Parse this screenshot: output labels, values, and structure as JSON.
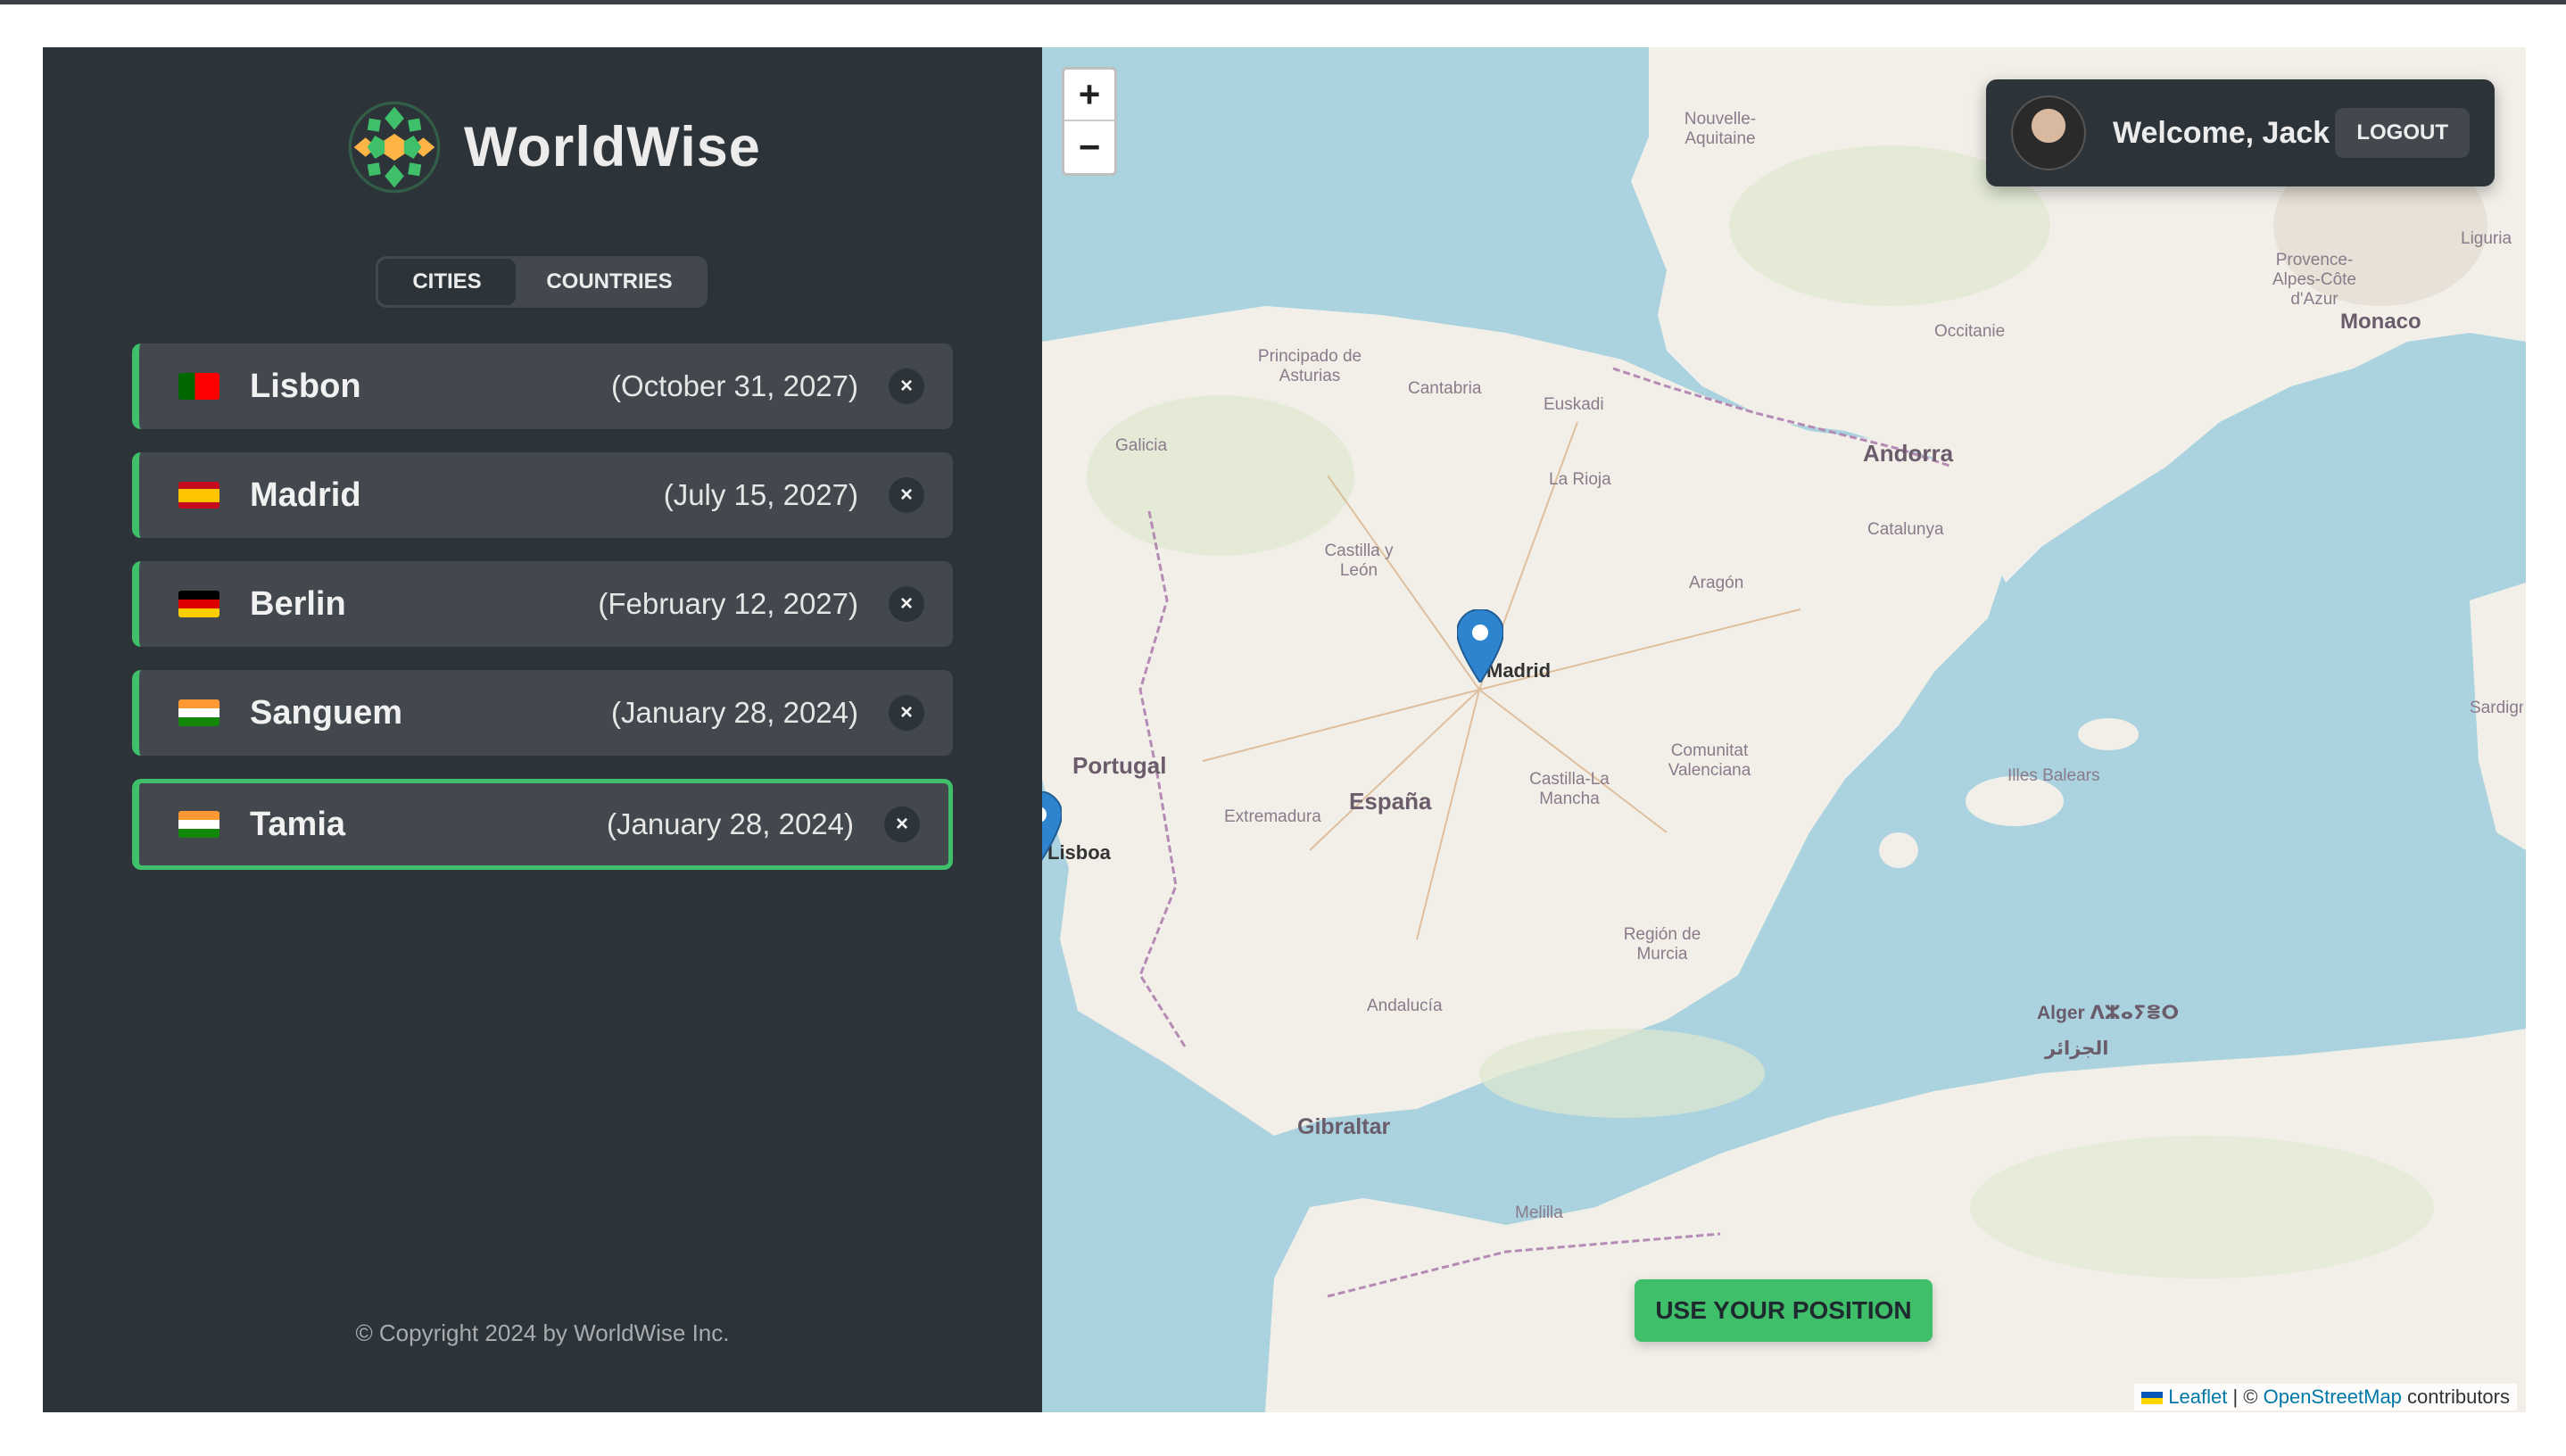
{
  "app": {
    "name": "WorldWise"
  },
  "tabs": [
    {
      "label": "Cities",
      "active": true
    },
    {
      "label": "Countries",
      "active": false
    }
  ],
  "cities": [
    {
      "name": "Lisbon",
      "date": "(October 31, 2027)",
      "flag": "portugal-flag-icon"
    },
    {
      "name": "Madrid",
      "date": "(July 15, 2027)",
      "flag": "spain-flag-icon"
    },
    {
      "name": "Berlin",
      "date": "(February 12, 2027)",
      "flag": "germany-flag-icon"
    },
    {
      "name": "Sanguem",
      "date": "(January 28, 2024)",
      "flag": "india-flag-icon"
    },
    {
      "name": "Tamia",
      "date": "(January 28, 2024)",
      "flag": "india-flag-icon",
      "active": true
    }
  ],
  "delete_label": "×",
  "footer": {
    "copyright": "© Copyright 2024 by WorldWise Inc."
  },
  "map": {
    "zoom_in": "+",
    "zoom_out": "−",
    "use_position": "Use your position",
    "labels": {
      "madrid": "Madrid",
      "lisboa": "Lisboa",
      "portugal": "Portugal",
      "espana": "España",
      "andorra": "Andorra",
      "monaco": "Monaco",
      "gibraltar": "Gibraltar",
      "alger": "Alger ⴷⵣⴰⵢⴻⵔ",
      "alger_ar": "الجزائر",
      "nouvelle_aquitaine": "Nouvelle-Aquitaine",
      "occitanie": "Occitanie",
      "catalunya": "Catalunya",
      "aragon": "Aragón",
      "la_rioja": "La Rioja",
      "euskadi": "Euskadi",
      "cantabria": "Cantabria",
      "asturias": "Principado de Asturias",
      "galicia": "Galicia",
      "castilla_leon": "Castilla y León",
      "castilla_mancha": "Castilla-La Mancha",
      "extremadura": "Extremadura",
      "andalucia": "Andalucía",
      "valenciana": "Comunitat Valenciana",
      "murcia": "Región de Murcia",
      "illes_balears": "Illes Balears",
      "melilla": "Melilla",
      "provence": "Provence-Alpes-Côte d'Azur",
      "liguria": "Liguria",
      "sardegna": "Sardigna / Sardegna"
    },
    "attribution": {
      "leaflet": "Leaflet",
      "separator": "| ©",
      "osm": "OpenStreetMap",
      "contributors": "contributors"
    }
  },
  "user": {
    "welcome": "Welcome, Jack",
    "logout": "Logout"
  },
  "colors": {
    "sidebar_bg": "#2d3439",
    "item_bg": "#42484d",
    "accent_green": "#3fbf6a",
    "sea": "#aad3df",
    "land": "#f2efe9"
  }
}
